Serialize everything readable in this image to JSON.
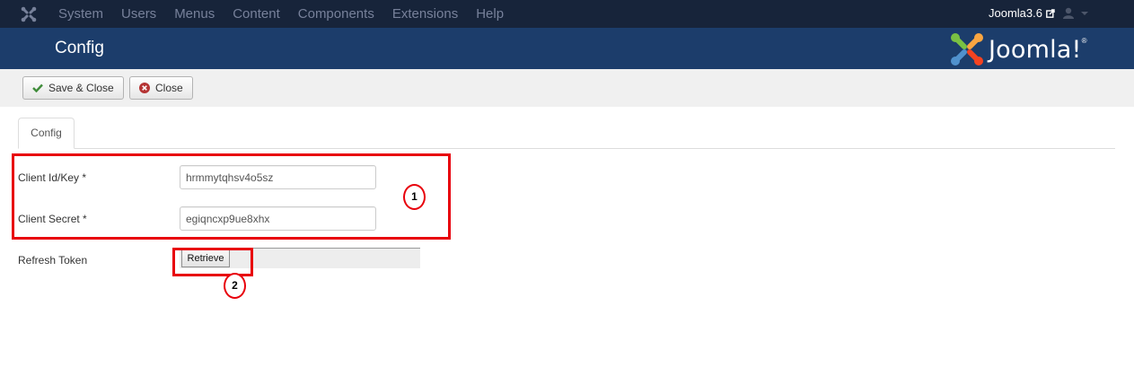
{
  "nav": {
    "menu": [
      "System",
      "Users",
      "Menus",
      "Content",
      "Components",
      "Extensions",
      "Help"
    ],
    "site_name": "Joomla3.6"
  },
  "header": {
    "title": "Config",
    "brand": "Joomla!",
    "brand_reg": "®"
  },
  "toolbar": {
    "save_close_label": "Save & Close",
    "close_label": "Close"
  },
  "tabs": [
    {
      "label": "Config"
    }
  ],
  "form": {
    "client_id_label": "Client Id/Key *",
    "client_id_value": "hrmmytqhsv4o5sz",
    "client_secret_label": "Client Secret *",
    "client_secret_value": "egiqncxp9ue8xhx",
    "refresh_token_label": "Refresh Token",
    "retrieve_label": "Retrieve"
  },
  "annotations": {
    "marker_1": "1",
    "marker_2": "2"
  },
  "colors": {
    "navbar": "#17243a",
    "header": "#1c3d6b",
    "annotation": "#e8000b",
    "save_icon": "#3f8c3a",
    "close_icon": "#b53434"
  },
  "icons": {
    "nav_logo": "joomla-logo-icon",
    "external": "external-link-icon",
    "user": "user-icon",
    "save": "check-icon",
    "close": "close-circle-icon"
  }
}
